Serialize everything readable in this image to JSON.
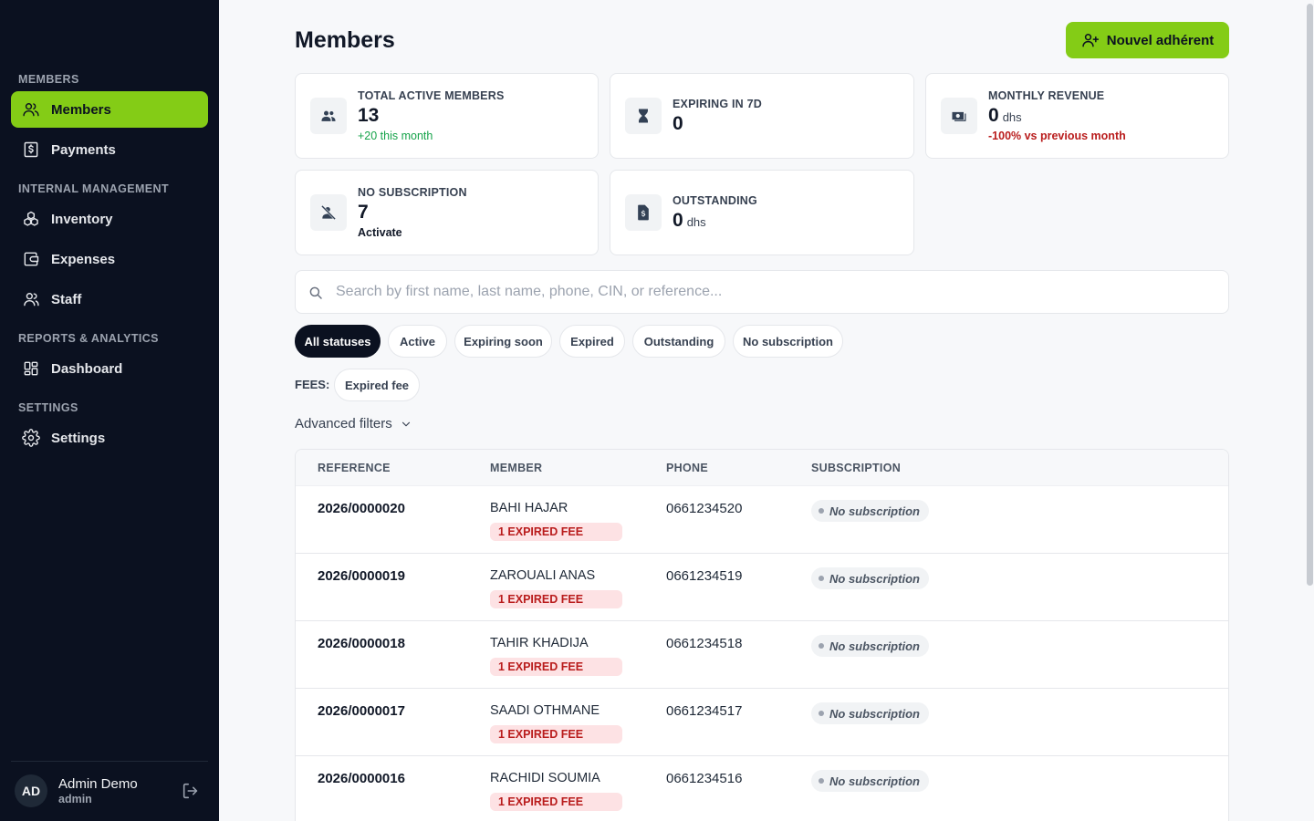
{
  "sidebar": {
    "sections": [
      {
        "label": "MEMBERS",
        "items": [
          {
            "label": "Members",
            "icon": "users-icon",
            "active": true
          },
          {
            "label": "Payments",
            "icon": "receipt-dollar-icon",
            "active": false
          }
        ]
      },
      {
        "label": "INTERNAL MANAGEMENT",
        "items": [
          {
            "label": "Inventory",
            "icon": "boxes-icon",
            "active": false
          },
          {
            "label": "Expenses",
            "icon": "wallet-icon",
            "active": false
          },
          {
            "label": "Staff",
            "icon": "user-group-icon",
            "active": false
          }
        ]
      },
      {
        "label": "REPORTS & ANALYTICS",
        "items": [
          {
            "label": "Dashboard",
            "icon": "dashboard-grid-icon",
            "active": false
          }
        ]
      },
      {
        "label": "SETTINGS",
        "items": [
          {
            "label": "Settings",
            "icon": "gear-icon",
            "active": false
          }
        ]
      }
    ],
    "user": {
      "initials": "AD",
      "name": "Admin Demo",
      "role": "admin"
    }
  },
  "header": {
    "title": "Members",
    "primary_button": "Nouvel adhérent"
  },
  "stats": [
    {
      "label": "TOTAL ACTIVE MEMBERS",
      "value": "13",
      "unit": "",
      "sub": "+20 this month",
      "icon": "people-icon"
    },
    {
      "label": "EXPIRING IN 7D",
      "value": "0",
      "unit": "",
      "sub": "",
      "icon": "hourglass-icon"
    },
    {
      "label": "MONTHLY REVENUE",
      "value": "0",
      "unit": "dhs",
      "sub": "-100% vs previous month",
      "icon": "cash-icon"
    },
    {
      "label": "NO SUBSCRIPTION",
      "value": "7",
      "unit": "",
      "sub": "Activate",
      "icon": "no-person-icon"
    },
    {
      "label": "OUTSTANDING",
      "value": "0",
      "unit": "dhs",
      "sub": "",
      "icon": "invoice-icon"
    }
  ],
  "search": {
    "placeholder": "Search by first name, last name, phone, CIN, or reference..."
  },
  "status_filters": [
    "All statuses",
    "Active",
    "Expiring soon",
    "Expired",
    "Outstanding",
    "No subscription"
  ],
  "active_status_filter": "All statuses",
  "fees_filter": {
    "label": "FEES:",
    "options": [
      "Expired fee"
    ]
  },
  "advanced_filters_label": "Advanced filters",
  "table": {
    "columns": [
      "REFERENCE",
      "MEMBER",
      "PHONE",
      "SUBSCRIPTION"
    ],
    "rows": [
      {
        "reference": "2026/0000020",
        "member": "BAHI HAJAR",
        "fee_badge": "1 EXPIRED FEE",
        "phone": "0661234520",
        "subscription": "No subscription"
      },
      {
        "reference": "2026/0000019",
        "member": "ZAROUALI ANAS",
        "fee_badge": "1 EXPIRED FEE",
        "phone": "0661234519",
        "subscription": "No subscription"
      },
      {
        "reference": "2026/0000018",
        "member": "TAHIR KHADIJA",
        "fee_badge": "1 EXPIRED FEE",
        "phone": "0661234518",
        "subscription": "No subscription"
      },
      {
        "reference": "2026/0000017",
        "member": "SAADI OTHMANE",
        "fee_badge": "1 EXPIRED FEE",
        "phone": "0661234517",
        "subscription": "No subscription"
      },
      {
        "reference": "2026/0000016",
        "member": "RACHIDI SOUMIA",
        "fee_badge": "1 EXPIRED FEE",
        "phone": "0661234516",
        "subscription": "No subscription"
      }
    ]
  },
  "colors": {
    "accent": "#84cc16",
    "sidebar_bg": "#0b1120",
    "danger": "#b91c1c",
    "success": "#16a34a"
  }
}
